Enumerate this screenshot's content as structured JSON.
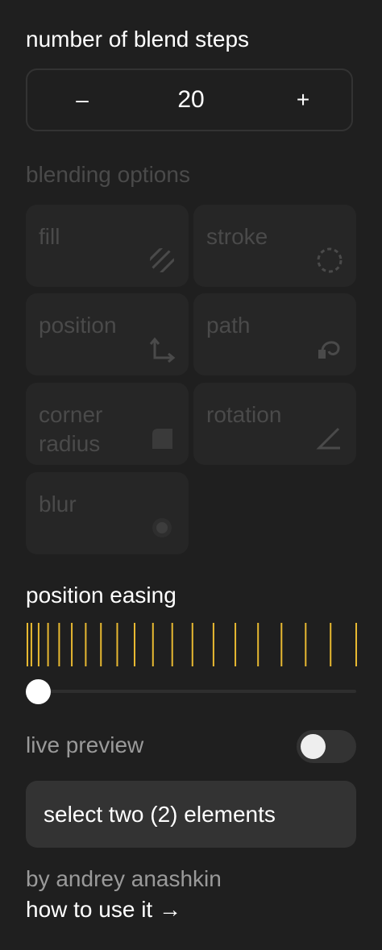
{
  "steps": {
    "title": "number of blend steps",
    "decrement_label": "–",
    "value": "20",
    "increment_label": "+"
  },
  "blending": {
    "title": "blending options",
    "options": [
      {
        "label": "fill",
        "icon": "fill-hatch-icon"
      },
      {
        "label": "stroke",
        "icon": "dashed-circle-icon"
      },
      {
        "label": "position",
        "icon": "position-arrows-icon"
      },
      {
        "label": "path",
        "icon": "path-node-icon"
      },
      {
        "label": "corner\nradius",
        "icon": "corner-radius-icon"
      },
      {
        "label": "rotation",
        "icon": "angle-icon"
      },
      {
        "label": "blur",
        "icon": "blur-dot-icon"
      }
    ]
  },
  "easing": {
    "title": "position easing",
    "steps": 20,
    "tick_color": "#e8b931",
    "slider_value": 0
  },
  "live_preview": {
    "label": "live preview",
    "enabled": false
  },
  "action": {
    "label": "select two (2) elements"
  },
  "footer": {
    "credit": "by andrey anashkin",
    "link": "how to use it →"
  },
  "colors": {
    "background": "#1f1f1f",
    "tile": "#262626",
    "disabled_text": "#4a4a4a",
    "accent": "#e8b931"
  }
}
